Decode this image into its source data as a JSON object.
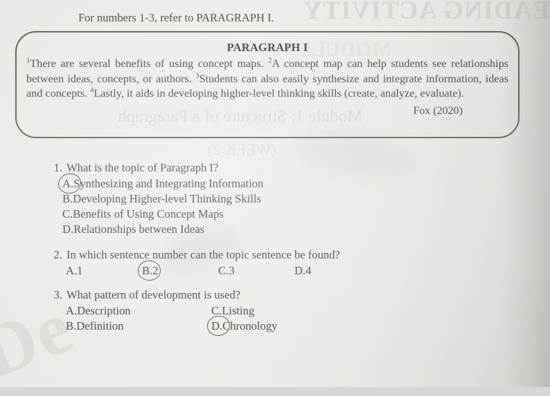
{
  "document": {
    "instruction": "For numbers 1-3, refer to PARAGRAPH I.",
    "watermark_text": "De",
    "showthrough": {
      "title": "READING ACTIVITY",
      "subtitle": "Module 1: Structure of a Paragraph",
      "week": "(WEEK 2)",
      "extra": "MODULE"
    }
  },
  "paragraph_box": {
    "heading": "PARAGRAPH I",
    "sentences": [
      {
        "marker": "1",
        "text": "There are several benefits of using concept maps."
      },
      {
        "marker": "2",
        "text": "A concept map can help students see relationships between ideas, concepts, or authors."
      },
      {
        "marker": "3",
        "text": "Students can also easily synthesize and integrate information, ideas and concepts."
      },
      {
        "marker": "4",
        "text": "Lastly, it aids in developing higher-level thinking skills (create, analyze, evaluate)."
      }
    ],
    "citation": "Fox  (2020)"
  },
  "questions": [
    {
      "number": "1.",
      "prompt": "What is the topic of Paragraph I?",
      "layout": "single-column",
      "options": [
        {
          "letter": "A.",
          "text": "Synthesizing and Integrating Information",
          "selected": true
        },
        {
          "letter": "B.",
          "text": "Developing Higher-level Thinking Skills",
          "selected": false
        },
        {
          "letter": "C.",
          "text": "Benefits of Using Concept Maps",
          "selected": false
        },
        {
          "letter": "D.",
          "text": "Relationships between Ideas",
          "selected": false
        }
      ]
    },
    {
      "number": "2.",
      "prompt": "In which sentence number can the topic sentence be found?",
      "layout": "four-column",
      "options": [
        {
          "letter": "A.",
          "text": "1",
          "selected": false
        },
        {
          "letter": "B.",
          "text": "2",
          "selected": true
        },
        {
          "letter": "C.",
          "text": "3",
          "selected": false
        },
        {
          "letter": "D.",
          "text": "4",
          "selected": false
        }
      ]
    },
    {
      "number": "3.",
      "prompt": "What pattern of development is used?",
      "layout": "two-column",
      "options": [
        {
          "letter": "A.",
          "text": "Description",
          "selected": false
        },
        {
          "letter": "B.",
          "text": "Definition",
          "selected": false
        },
        {
          "letter": "C.",
          "text": "Listing",
          "selected": false
        },
        {
          "letter": "D.",
          "text": "Chronology",
          "selected": true
        }
      ]
    }
  ],
  "colors": {
    "paper": "#ecebe7",
    "ink": "#3b3734",
    "box_border": "#594f4c",
    "annotation_ink": "#4d4340",
    "showthrough": "#b9b8b3"
  }
}
